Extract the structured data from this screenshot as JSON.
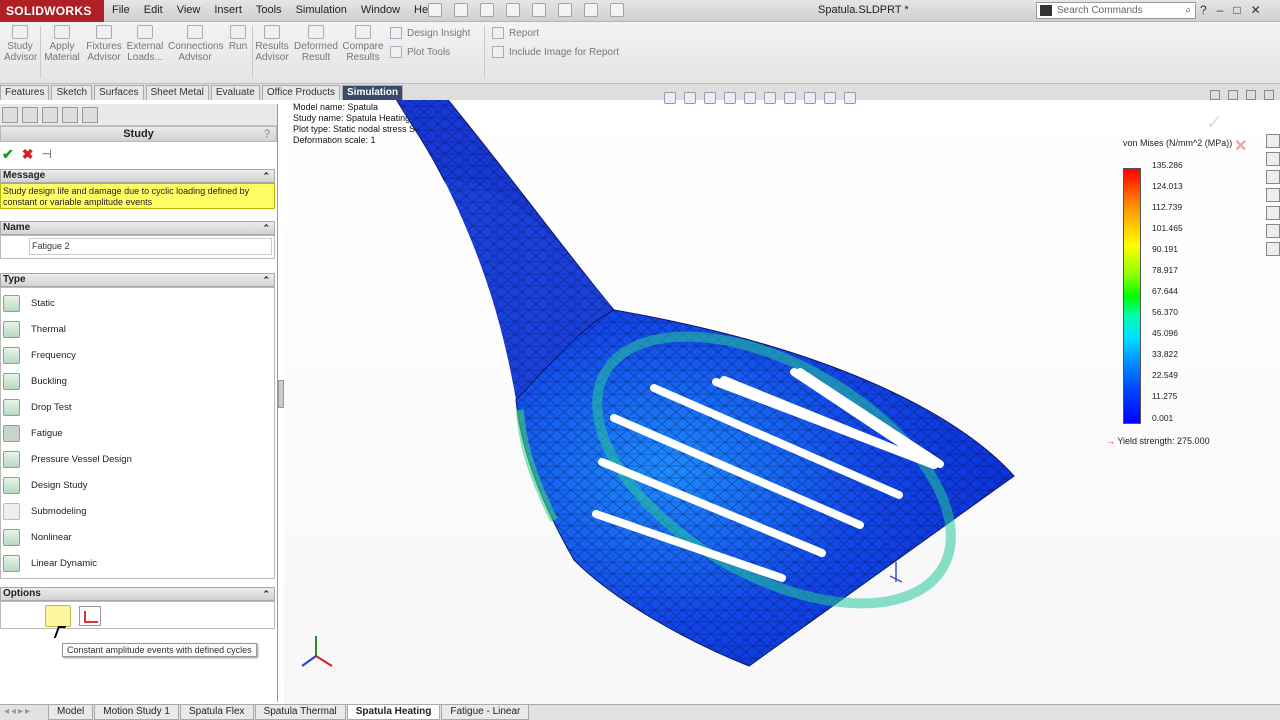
{
  "app": {
    "logo": "SOLIDWORKS",
    "document_title": "Spatula.SLDPRT *"
  },
  "menu": [
    "File",
    "Edit",
    "View",
    "Insert",
    "Tools",
    "Simulation",
    "Window",
    "Help"
  ],
  "search": {
    "placeholder": "Search Commands"
  },
  "ribbon": {
    "study_advisor": "Study Advisor",
    "apply_material": "Apply Material",
    "fixtures_advisor": "Fixtures Advisor",
    "external_loads": "External Loads...",
    "connections_advisor": "Connections Advisor",
    "run": "Run",
    "results_advisor": "Results Advisor",
    "deformed_result": "Deformed Result",
    "compare_results": "Compare Results",
    "design_insight": "Design Insight",
    "plot_tools": "Plot Tools",
    "report": "Report",
    "include_image": "Include Image for Report"
  },
  "cm_tabs": [
    "Features",
    "Sketch",
    "Surfaces",
    "Sheet Metal",
    "Evaluate",
    "Office Products",
    "Simulation"
  ],
  "panel": {
    "title": "Study",
    "help": "?",
    "message_header": "Message",
    "message_text": "Study design life and damage due to cyclic loading defined by constant or variable amplitude events",
    "name_header": "Name",
    "name_value": "Fatigue 2",
    "type_header": "Type",
    "types": [
      "Static",
      "Thermal",
      "Frequency",
      "Buckling",
      "Drop Test",
      "Fatigue",
      "Pressure Vessel Design",
      "Design Study",
      "Submodeling",
      "Nonlinear",
      "Linear Dynamic"
    ],
    "options_header": "Options",
    "tooltip": "Constant amplitude events with defined cycles"
  },
  "plot_info": {
    "model_name": "Model name: Spatula",
    "study_name": "Study name: Spatula Heating(-Default-)",
    "plot_type": "Plot type: Static nodal stress Stress1",
    "deformation": "Deformation scale: 1"
  },
  "legend": {
    "title": "von Mises (N/mm^2 (MPa))",
    "values": [
      "135.286",
      "124.013",
      "112.739",
      "101.465",
      "90.191",
      "78.917",
      "67.644",
      "56.370",
      "45.096",
      "33.822",
      "22.549",
      "11.275",
      "0.001"
    ],
    "yield": "Yield strength: 275.000"
  },
  "bottom_tabs": [
    "Model",
    "Motion Study 1",
    "Spatula Flex",
    "Spatula Thermal",
    "Spatula Heating",
    "Fatigue - Linear"
  ],
  "bottom_active": "Spatula Heating"
}
